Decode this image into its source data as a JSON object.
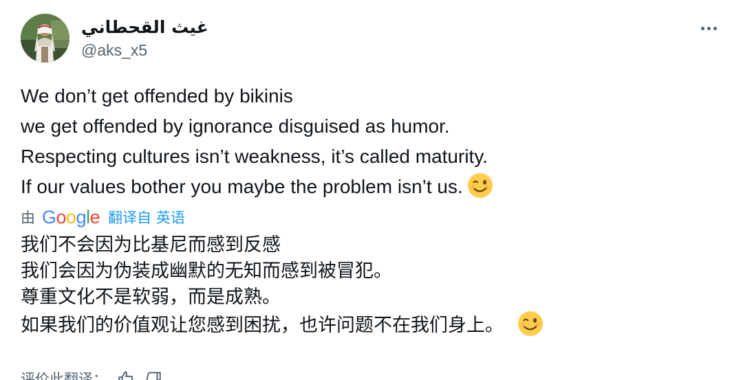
{
  "author": {
    "display_name": "غيث القحطاني",
    "handle": "@aks_x5"
  },
  "menu": {
    "icon": "more-horizontal-icon"
  },
  "tweet": {
    "lines": [
      "We don’t get offended by bikinis",
      "we get offended by ignorance disguised as humor.",
      "Respecting cultures isn’t weakness, it’s called maturity.",
      "If our values bother you maybe the problem isn’t us."
    ],
    "emoji": "winking-face-emoji"
  },
  "translation": {
    "by_label": "由",
    "provider": "Google",
    "link_label": "翻译自 英语",
    "lines": [
      "我们不会因为比基尼而感到反感",
      "我们会因为伪装成幽默的无知而感到被冒犯。",
      "尊重文化不是软弱，而是成熟。",
      "如果我们的价值观让您感到困扰，也许问题不在我们身上。"
    ],
    "emoji": "winking-face-emoji"
  },
  "rate": {
    "label": "评价此翻译：",
    "icons": [
      "thumbs-up-icon",
      "thumbs-down-icon"
    ]
  }
}
